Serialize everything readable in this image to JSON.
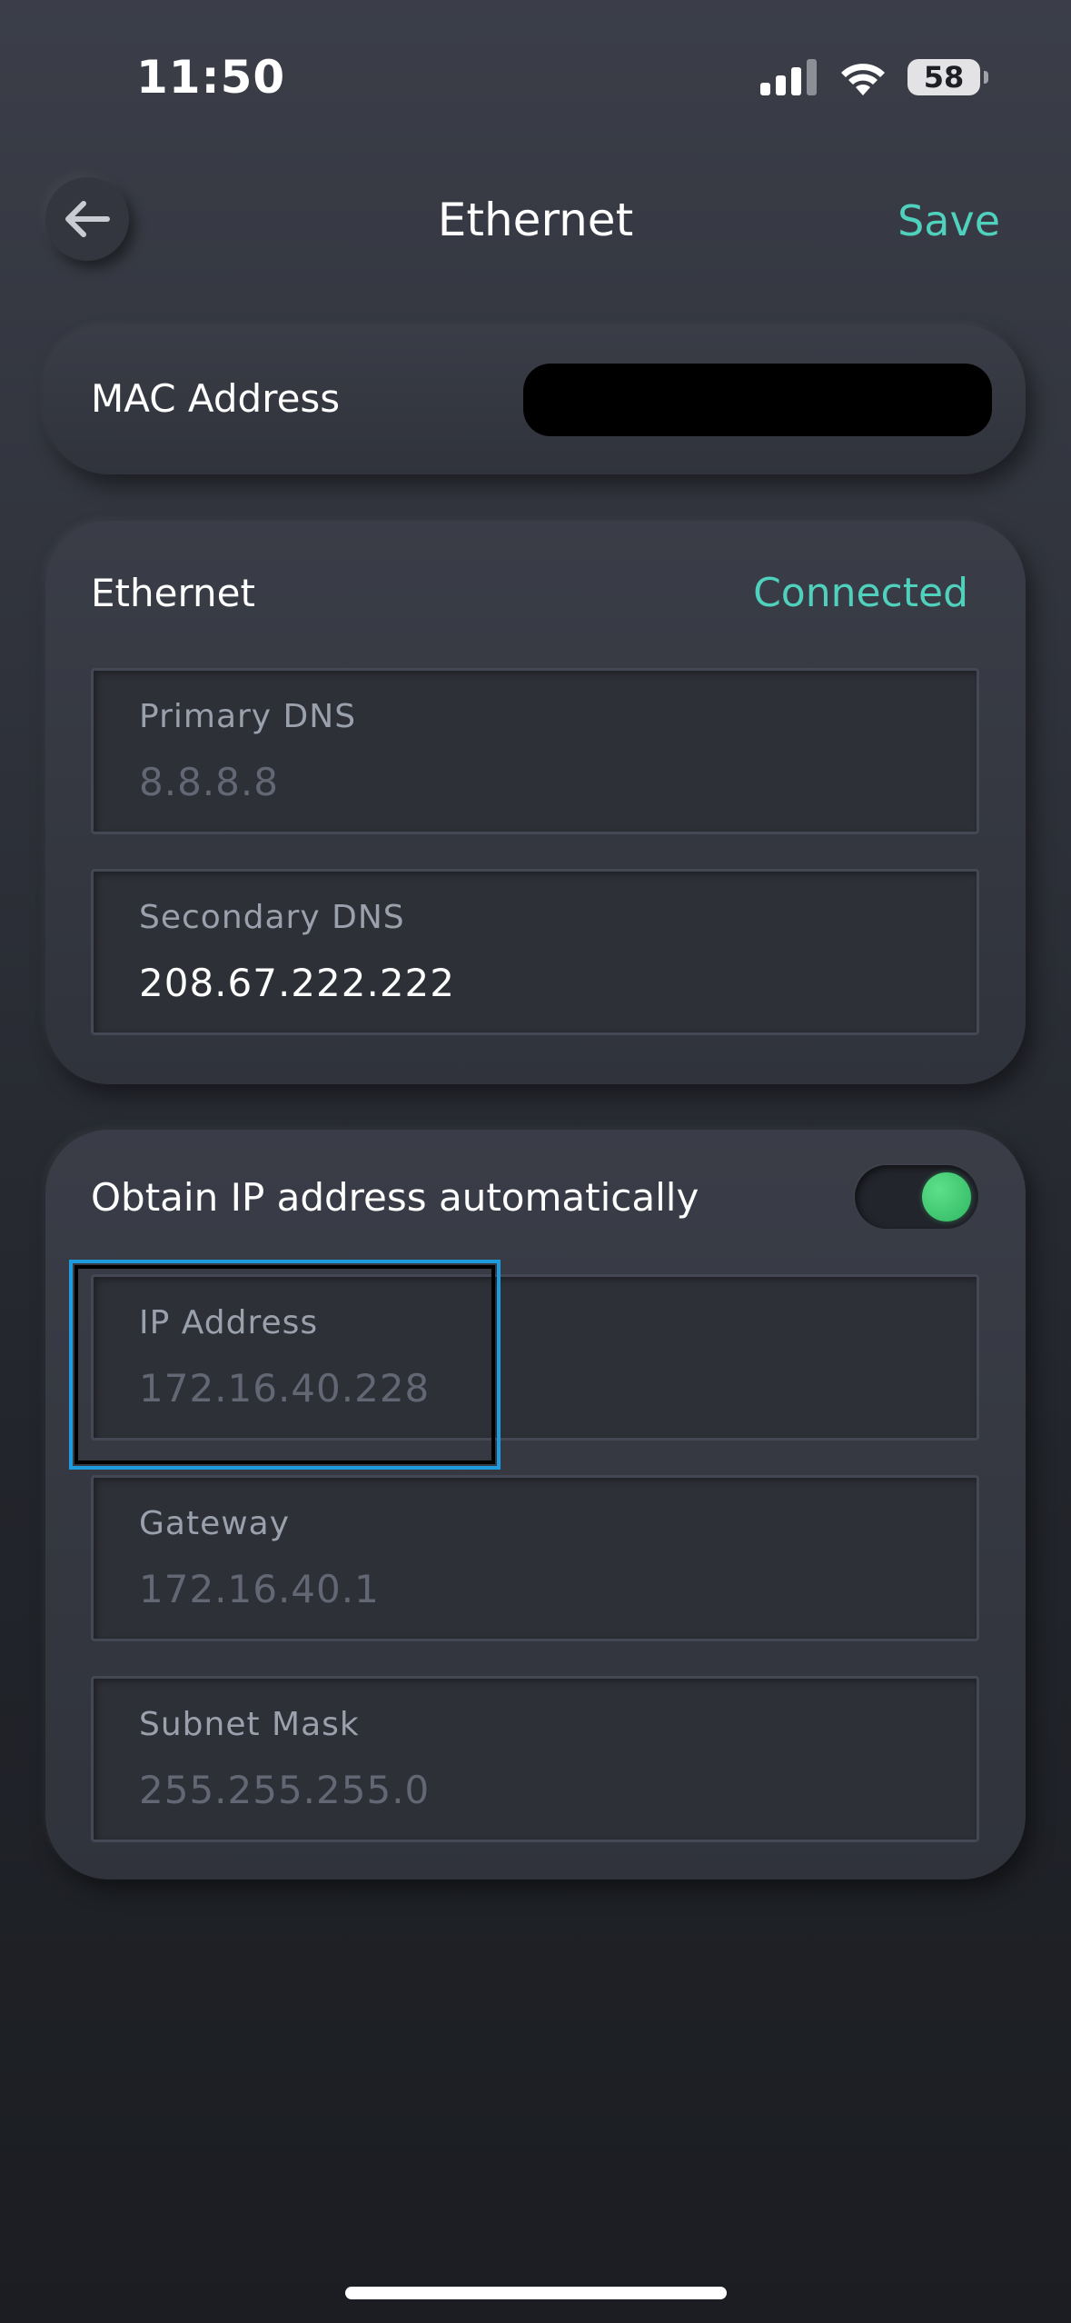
{
  "status_bar": {
    "time": "11:50",
    "battery": "58",
    "signal_icon": "cellular-signal-icon",
    "wifi_icon": "wifi-icon"
  },
  "nav": {
    "back_icon": "arrow-left-icon",
    "title": "Ethernet",
    "save_label": "Save"
  },
  "mac": {
    "label": "MAC Address"
  },
  "ethernet": {
    "title": "Ethernet",
    "status": "Connected",
    "primary_dns": {
      "label": "Primary DNS",
      "value": "8.8.8.8"
    },
    "secondary_dns": {
      "label": "Secondary DNS",
      "value": "208.67.222.222"
    }
  },
  "ip_settings": {
    "title": "Obtain IP address automatically",
    "auto_enabled": true,
    "ip_address": {
      "label": "IP Address",
      "value": "172.16.40.228"
    },
    "gateway": {
      "label": "Gateway",
      "value": "172.16.40.1"
    },
    "subnet_mask": {
      "label": "Subnet Mask",
      "value": "255.255.255.0"
    }
  },
  "colors": {
    "accent": "#4fd1bd",
    "toggle_on": "#3ccd72",
    "highlight": "#1e9bdc"
  }
}
